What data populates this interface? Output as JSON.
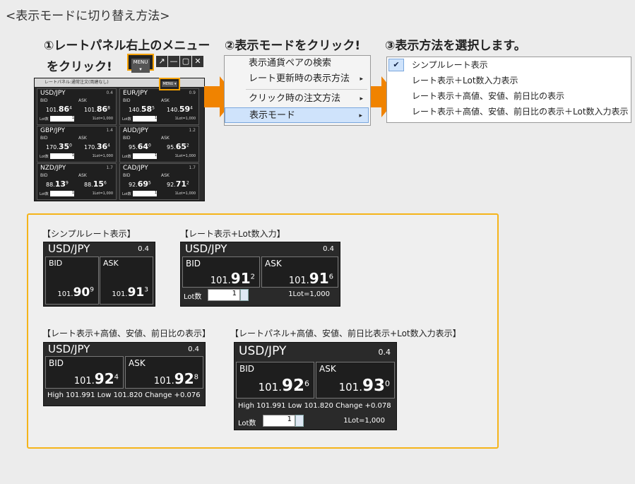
{
  "header": "<表示モードに切り替え方法>",
  "steps": {
    "s1a": "①レートパネル右上のメニュー",
    "s1b": "をクリック!",
    "s2": "②表示モードをクリック!",
    "s3": "③表示方法を選択します。"
  },
  "toolbar": {
    "menu_label": "MENU ▾"
  },
  "mini_window": {
    "title": "レートパネル:通常注文(両建なし)",
    "panels": [
      {
        "ccy": "USD/JPY",
        "spread": "0.4",
        "bid_label": "BID",
        "ask_label": "ASK",
        "bid_pre": "101.",
        "bid_big": "86",
        "bid_sup": "4",
        "ask_pre": "101.",
        "ask_big": "86",
        "ask_sup": "8",
        "lot_label": "Lot数",
        "lot_value": "1",
        "lot_unit": "1Lot=1,000"
      },
      {
        "ccy": "EUR/JPY",
        "spread": "0.9",
        "bid_label": "BID",
        "ask_label": "ASK",
        "bid_pre": "140.",
        "bid_big": "58",
        "bid_sup": "5",
        "ask_pre": "140.",
        "ask_big": "59",
        "ask_sup": "4",
        "lot_label": "Lot数",
        "lot_value": "1",
        "lot_unit": "1Lot=1,000"
      },
      {
        "ccy": "GBP/JPY",
        "spread": "1.4",
        "bid_label": "BID",
        "ask_label": "ASK",
        "bid_pre": "170.",
        "bid_big": "35",
        "bid_sup": "0",
        "ask_pre": "170.",
        "ask_big": "36",
        "ask_sup": "4",
        "lot_label": "Lot数",
        "lot_value": "1",
        "lot_unit": "1Lot=1,000"
      },
      {
        "ccy": "AUD/JPY",
        "spread": "1.2",
        "bid_label": "BID",
        "ask_label": "ASK",
        "bid_pre": "95.",
        "bid_big": "64",
        "bid_sup": "0",
        "ask_pre": "95.",
        "ask_big": "65",
        "ask_sup": "2",
        "lot_label": "Lot数",
        "lot_value": "1",
        "lot_unit": "1Lot=1,000"
      },
      {
        "ccy": "NZD/JPY",
        "spread": "1.7",
        "bid_label": "BID",
        "ask_label": "ASK",
        "bid_pre": "88.",
        "bid_big": "13",
        "bid_sup": "9",
        "ask_pre": "88.",
        "ask_big": "15",
        "ask_sup": "6",
        "lot_label": "Lot数",
        "lot_value": "1",
        "lot_unit": "1Lot=1,000"
      },
      {
        "ccy": "CAD/JPY",
        "spread": "1.7",
        "bid_label": "BID",
        "ask_label": "ASK",
        "bid_pre": "92.",
        "bid_big": "69",
        "bid_sup": "5",
        "ask_pre": "92.",
        "ask_big": "71",
        "ask_sup": "2",
        "lot_label": "Lot数",
        "lot_value": "1",
        "lot_unit": "1Lot=1,000"
      }
    ]
  },
  "context_menu": {
    "items": [
      "表示通貨ペアの検索",
      "レート更新時の表示方法",
      "クリック時の注文方法",
      "表示モード"
    ],
    "submenu_marker": "▸"
  },
  "modes": {
    "check": "✔",
    "items": [
      "シンプルレート表示",
      "レート表示＋Lot数入力表示",
      "レート表示＋高値、安値、前日比の表示",
      "レート表示＋高値、安値、前日比の表示＋Lot数入力表示"
    ]
  },
  "examples": {
    "t1": "【シンプルレート表示】",
    "t2": "【レート表示+Lot数入力】",
    "t3": "【レート表示+高値、安値、前日比の表示】",
    "t4": "【レートパネル+高値、安値、前日比表示+Lot数入力表示】",
    "ccy": "USD/JPY",
    "spread": "0.4",
    "bid": "BID",
    "ask": "ASK",
    "p1": {
      "bid_pre": "101.",
      "bid_big": "90",
      "bid_sup": "9",
      "ask_pre": "101.",
      "ask_big": "91",
      "ask_sup": "3"
    },
    "p2": {
      "bid_pre": "101.",
      "bid_big": "91",
      "bid_sup": "2",
      "ask_pre": "101.",
      "ask_big": "91",
      "ask_sup": "6"
    },
    "p3": {
      "bid_pre": "101.",
      "bid_big": "92",
      "bid_sup": "4",
      "ask_pre": "101.",
      "ask_big": "92",
      "ask_sup": "8",
      "hlc": "High 101.991 Low 101.820 Change +0.076"
    },
    "p4": {
      "bid_pre": "101.",
      "bid_big": "92",
      "bid_sup": "6",
      "ask_pre": "101.",
      "ask_big": "93",
      "ask_sup": "0",
      "hlc": "High 101.991 Low 101.820 Change +0.078"
    },
    "lot_label": "Lot数",
    "lot_value": "1",
    "lot_unit": "1Lot=1,000"
  }
}
